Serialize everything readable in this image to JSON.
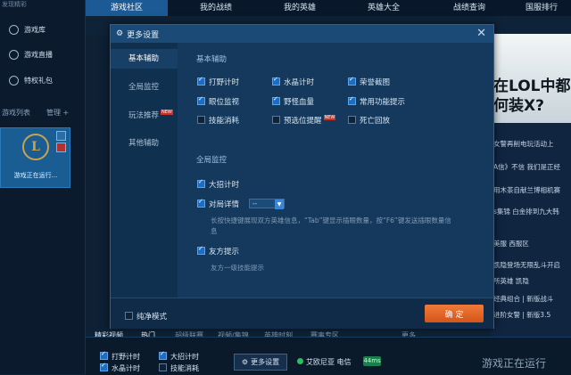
{
  "left_nav": {
    "header": "发现精彩",
    "items": [
      {
        "label": "游戏库",
        "icon": "grid-icon"
      },
      {
        "label": "游戏直播",
        "icon": "play-icon"
      },
      {
        "label": "特权礼包",
        "icon": "gift-icon"
      }
    ],
    "game_list_title": "游戏列表",
    "manage_label": "管理 +",
    "game_tile_status": "游戏正在运行..."
  },
  "top_tabs": [
    "游戏社区",
    "我的战绩",
    "我的英雄",
    "英雄大全",
    "战绩查询",
    "国服排行"
  ],
  "right_panel": {
    "banner_text": "在LOL中都 何装X?",
    "news": [
      "女警再削电玩活动上",
      "A信》不信 我们是正经",
      "用木茶自献兰博相机赛",
      "s集锦 白金排到九大韩",
      "美服  西服区",
      "凯隐登场无限乱斗开启",
      "所英雄 凯隐",
      "经典组合 | 新版战斗",
      "进阶女警 | 新版3.5"
    ]
  },
  "dialog": {
    "title": "更多设置",
    "side_tabs": [
      {
        "label": "基本辅助",
        "new": false
      },
      {
        "label": "全局监控",
        "new": false
      },
      {
        "label": "玩法推荐",
        "new": true,
        "tag": "NEW"
      },
      {
        "label": "其他辅助",
        "new": false
      }
    ],
    "section_basic": "基本辅助",
    "basic_options": [
      {
        "label": "打野计时",
        "checked": true
      },
      {
        "label": "水晶计时",
        "checked": true
      },
      {
        "label": "荣誉截图",
        "checked": true
      },
      {
        "label": "眼位监视",
        "checked": true
      },
      {
        "label": "野怪血量",
        "checked": true
      },
      {
        "label": "常用功能提示",
        "checked": true
      },
      {
        "label": "技能消耗",
        "checked": false
      },
      {
        "label": "预选位提醒",
        "checked": false,
        "tag": "NEW"
      },
      {
        "label": "死亡回放",
        "checked": false
      }
    ],
    "section_global": "全局监控",
    "global_options": [
      {
        "label": "大招计时",
        "checked": true
      },
      {
        "label": "对局详情",
        "checked": true,
        "dropdown": "--"
      },
      {
        "label": "友方提示",
        "checked": true
      }
    ],
    "detail_note_1": "长按快捷键展现双方英雄信息，“Tab”键显示插眼数量，按“F6”键发送插眼数量信",
    "detail_note_2": "息",
    "friend_note": "友方一级技能提示",
    "pure_mode_label": "纯净模式",
    "pure_mode_checked": false,
    "ok_label": "确 定"
  },
  "bottom": {
    "tabs": [
      "精彩视频",
      "热门",
      "超级联赛",
      "视频/集锦",
      "英雄时刻",
      "赛事专区",
      "更多"
    ],
    "checks": [
      {
        "label": "打野计时",
        "checked": true
      },
      {
        "label": "大招计时",
        "checked": true
      },
      {
        "label": "水晶计时",
        "checked": true
      },
      {
        "label": "技能消耗",
        "checked": false
      }
    ],
    "more_settings_label": "更多设置",
    "server_label": "艾欧尼亚 电信",
    "ping": "44ms",
    "running_label": "游戏正在运行"
  }
}
